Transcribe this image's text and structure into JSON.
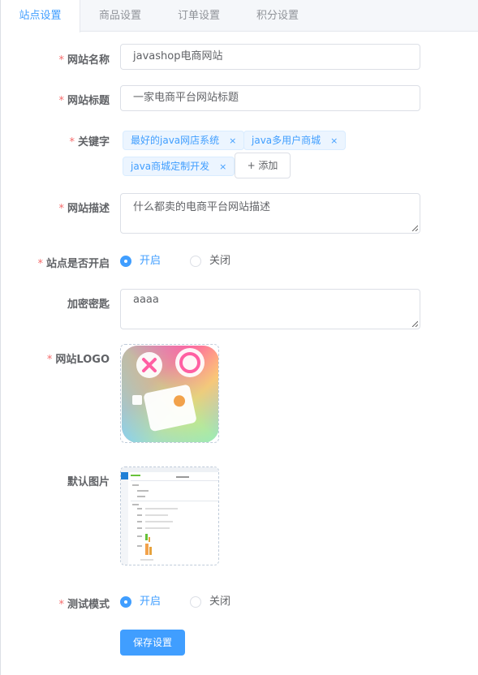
{
  "tabs": [
    {
      "label": "站点设置"
    },
    {
      "label": "商品设置"
    },
    {
      "label": "订单设置"
    },
    {
      "label": "积分设置"
    }
  ],
  "form": {
    "site_name": {
      "label": "网站名称",
      "value": "javashop电商网站"
    },
    "site_title": {
      "label": "网站标题",
      "value": "一家电商平台网站标题"
    },
    "keywords": {
      "label": "关键字",
      "tags": [
        "最好的java网店系统",
        "java多用户商城",
        "java商城定制开发"
      ],
      "close_symbol": "×",
      "add_label": "+ 添加"
    },
    "site_desc": {
      "label": "网站描述",
      "value": "什么都卖的电商平台网站描述"
    },
    "site_open": {
      "label": "站点是否开启",
      "options": [
        "开启",
        "关闭"
      ],
      "selected": "开启"
    },
    "secret_key": {
      "label": "加密密匙",
      "value": "aaaa"
    },
    "logo": {
      "label": "网站LOGO"
    },
    "default_image": {
      "label": "默认图片"
    },
    "test_mode": {
      "label": "测试模式",
      "options": [
        "开启",
        "关闭"
      ],
      "selected": "开启"
    },
    "required_mark": "*",
    "save_label": "保存设置"
  },
  "colors": {
    "primary": "#409eff",
    "required": "#f56c6c",
    "border": "#dcdfe6",
    "text": "#606266"
  }
}
